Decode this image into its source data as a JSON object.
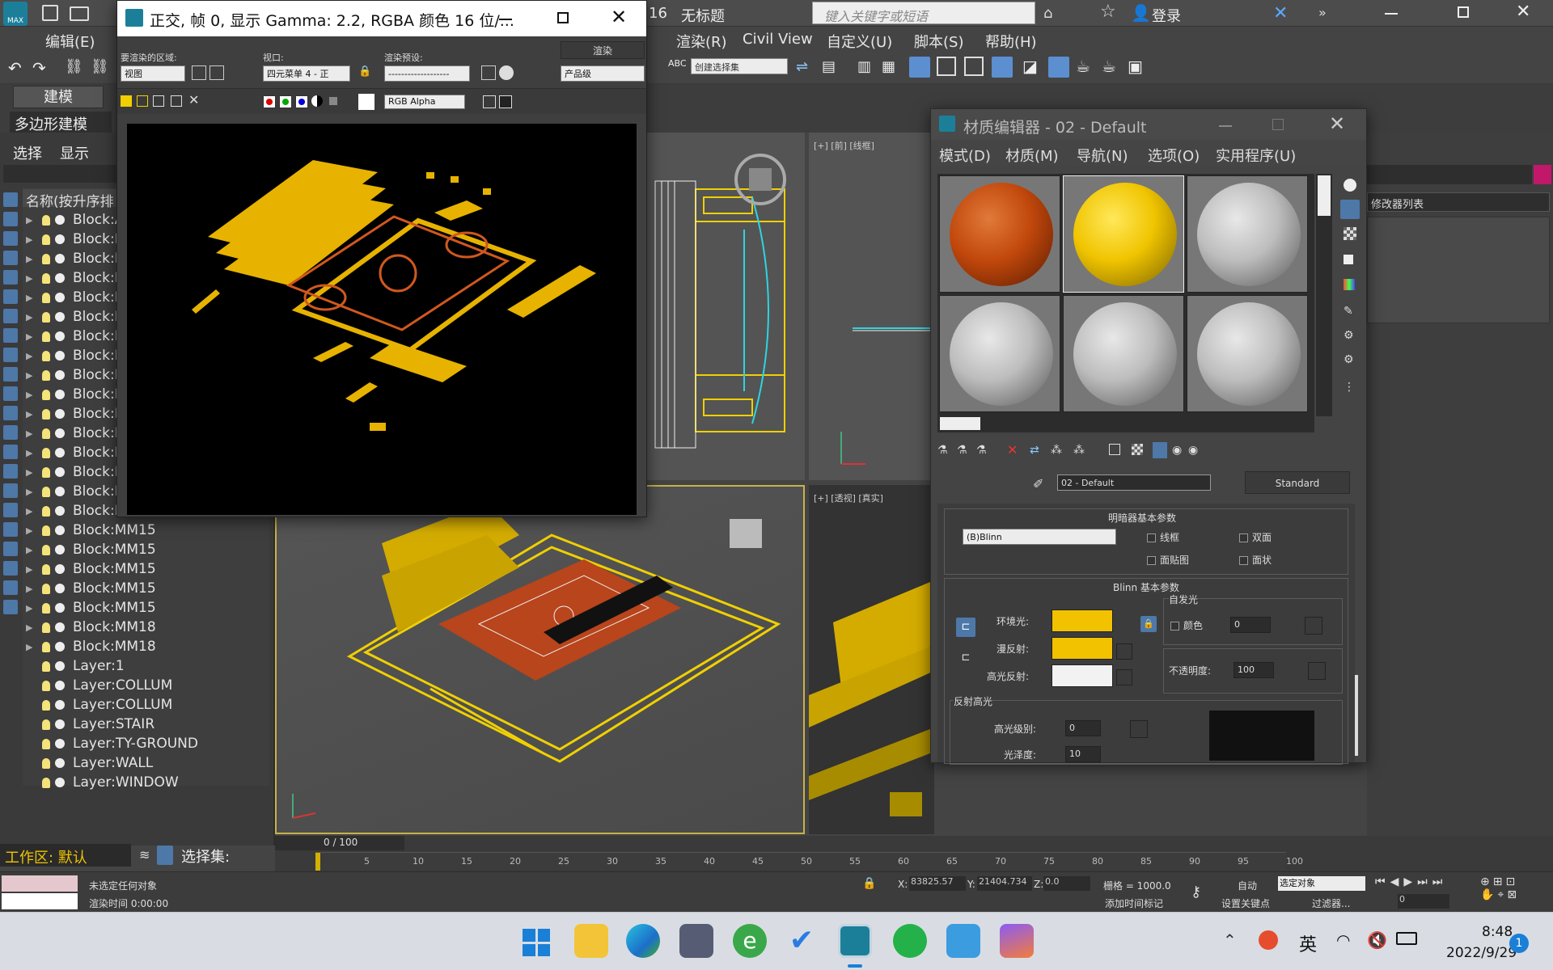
{
  "app": {
    "doc_title": "无标题",
    "frame_num_fragment": "16",
    "search_placeholder": "键入关键字或短语",
    "login_label": "登录"
  },
  "menus": [
    "编辑(E)",
    "渲染(R)",
    "Civil View",
    "自定义(U)",
    "脚本(S)",
    "帮助(H)"
  ],
  "toolbar": {
    "selection_set_placeholder": "创建选择集"
  },
  "ribbon": {
    "tab_modeling": "建模",
    "subtab_poly": "多边形建模"
  },
  "scene_explorer": {
    "select_label": "选择",
    "display_label": "显示",
    "column_header": "名称(按升序排",
    "items": [
      {
        "label": "Block:A",
        "expandable": true
      },
      {
        "label": "Block:M",
        "expandable": true
      },
      {
        "label": "Block:M",
        "expandable": true
      },
      {
        "label": "Block:M",
        "expandable": true
      },
      {
        "label": "Block:M",
        "expandable": true
      },
      {
        "label": "Block:M",
        "expandable": true
      },
      {
        "label": "Block:M",
        "expandable": true
      },
      {
        "label": "Block:M",
        "expandable": true
      },
      {
        "label": "Block:M",
        "expandable": true
      },
      {
        "label": "Block:M",
        "expandable": true
      },
      {
        "label": "Block:M",
        "expandable": true
      },
      {
        "label": "Block:M",
        "expandable": true
      },
      {
        "label": "Block:M",
        "expandable": true
      },
      {
        "label": "Block:M",
        "expandable": true
      },
      {
        "label": "Block:M",
        "expandable": true
      },
      {
        "label": "Block:M",
        "expandable": true
      },
      {
        "label": "Block:MM15",
        "expandable": true
      },
      {
        "label": "Block:MM15",
        "expandable": true
      },
      {
        "label": "Block:MM15",
        "expandable": true
      },
      {
        "label": "Block:MM15",
        "expandable": true
      },
      {
        "label": "Block:MM15",
        "expandable": true
      },
      {
        "label": "Block:MM18",
        "expandable": true
      },
      {
        "label": "Block:MM18",
        "expandable": true
      },
      {
        "label": "Layer:1",
        "expandable": false
      },
      {
        "label": "Layer:COLLUM",
        "expandable": false
      },
      {
        "label": "Layer:COLLUM",
        "expandable": false
      },
      {
        "label": "Layer:STAIR",
        "expandable": false
      },
      {
        "label": "Layer:TY-GROUND",
        "expandable": false
      },
      {
        "label": "Layer:WALL",
        "expandable": false
      },
      {
        "label": "Layer:WINDOW",
        "expandable": false
      }
    ],
    "workspace_label": "工作区: 默认",
    "selection_set_label": "选择集:"
  },
  "viewports": {
    "front_label": "[+] [前] [线框]",
    "persp_right_label": "[+] [透视] [真实]"
  },
  "render_window": {
    "title": "正交, 帧 0, 显示 Gamma: 2.2, RGBA 颜色 16 位/...",
    "area_label": "要渲染的区域:",
    "area_value": "视图",
    "viewport_label": "视口:",
    "viewport_value": "四元菜单 4 - 正",
    "preset_label": "渲染预设:",
    "preset_value": "-------------------",
    "render_button": "渲染",
    "quality_value": "产品级",
    "channel_value": "RGB Alpha"
  },
  "material_editor": {
    "title": "材质编辑器 - 02 - Default",
    "menus": [
      "模式(D)",
      "材质(M)",
      "导航(N)",
      "选项(O)",
      "实用程序(U)"
    ],
    "slot_colors": [
      "#c2480c",
      "#f0c400",
      "#bdbdbd",
      "#bdbdbd",
      "#bdbdbd",
      "#bdbdbd"
    ],
    "material_name": "02 - Default",
    "material_type": "Standard",
    "shader_rollout": "明暗器基本参数",
    "shader_value": "(B)Blinn",
    "wire_label": "线框",
    "two_sided_label": "双面",
    "face_map_label": "面贴图",
    "faceted_label": "面状",
    "blinn_rollout": "Blinn 基本参数",
    "self_illum_label": "自发光",
    "color_label": "颜色",
    "self_illum_value": "0",
    "ambient_label": "环境光:",
    "diffuse_label": "漫反射:",
    "specular_label": "高光反射:",
    "ambient_color": "#f2c200",
    "diffuse_color": "#f2c200",
    "specular_color": "#f2f2f2",
    "opacity_label": "不透明度:",
    "opacity_value": "100",
    "spec_highlights_label": "反射高光",
    "spec_level_label": "高光级别:",
    "spec_level_value": "0",
    "glossiness_label": "光泽度:",
    "glossiness_value": "10"
  },
  "right_panel": {
    "modifier_list": "修改器列表"
  },
  "timeline": {
    "frame_counter": "0 / 100",
    "ticks": [
      "5",
      "10",
      "15",
      "20",
      "25",
      "30",
      "35",
      "40",
      "45",
      "50",
      "55",
      "60",
      "65",
      "70",
      "75",
      "80",
      "85",
      "90",
      "95",
      "100"
    ]
  },
  "status": {
    "message": "未选定任何对象",
    "render_time": "渲染时间 0:00:00",
    "x_label": "X:",
    "x_value": "83825.57",
    "y_label": "Y:",
    "y_value": "21404.734",
    "z_label": "Z:",
    "z_value": "0.0",
    "grid_label": "栅格 = 1000.0",
    "add_time_tag": "添加时间标记",
    "auto_label": "自动",
    "selected_obj": "选定对象",
    "set_key": "设置关键点",
    "filters": "过滤器...",
    "frame_value": "0"
  },
  "taskbar": {
    "ime_label": "英",
    "time": "8:48",
    "date": "2022/9/29",
    "notification_count": "1"
  }
}
